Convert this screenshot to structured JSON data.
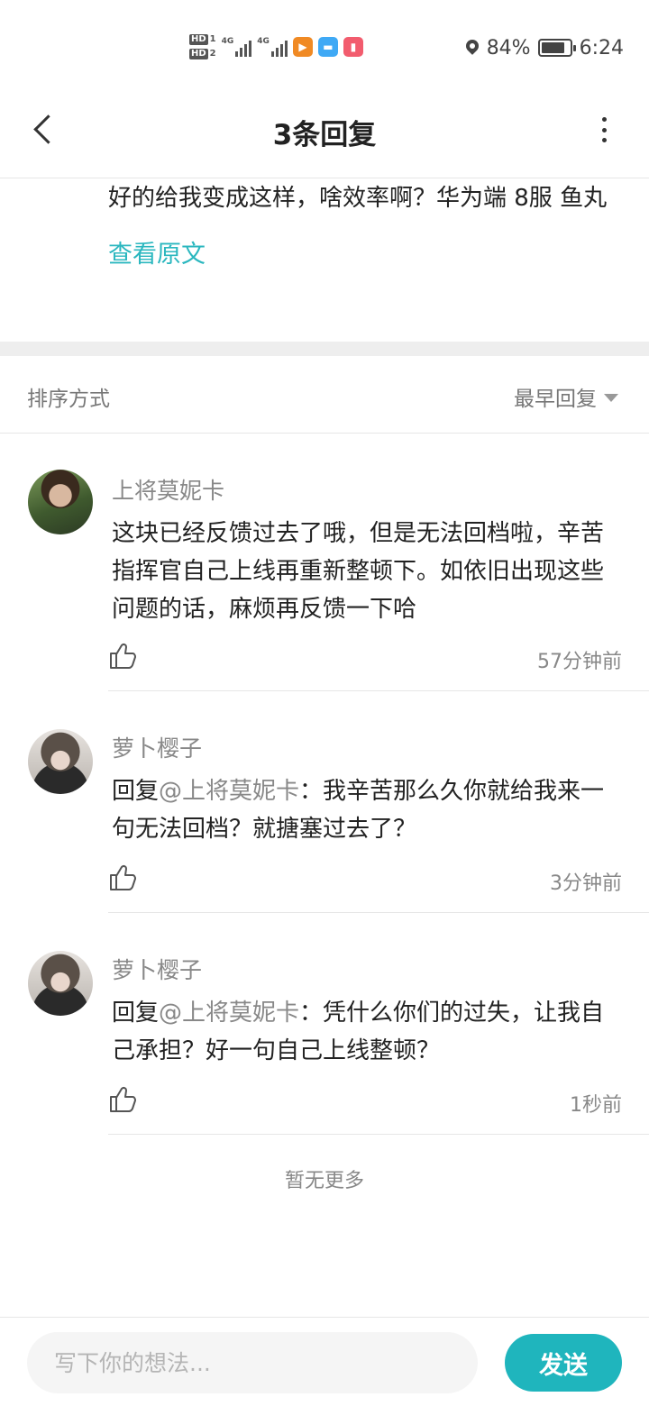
{
  "status_bar": {
    "hd1": "HD",
    "hd1_num": "1",
    "hd2": "HD",
    "hd2_num": "2",
    "net1": "4G",
    "net2": "4G",
    "battery": "84%",
    "time": "6:24",
    "battery_level": 0.84
  },
  "header": {
    "title": "3条回复"
  },
  "original": {
    "text": "好的给我变成这样，啥效率啊？华为端 8服 鱼丸",
    "view_link": "查看原文"
  },
  "sort": {
    "label": "排序方式",
    "value": "最早回复"
  },
  "comments": [
    {
      "name": "上将莫妮卡",
      "prefix": "",
      "mention": "",
      "body": "这块已经反馈过去了哦，但是无法回档啦，辛苦指挥官自己上线再重新整顿下。如依旧出现这些问题的话，麻烦再反馈一下哈",
      "time": "57分钟前"
    },
    {
      "name": "萝卜樱子",
      "prefix": "回复",
      "mention": "@上将莫妮卡",
      "body": "：我辛苦那么久你就给我来一句无法回档？就搪塞过去了？",
      "time": "3分钟前"
    },
    {
      "name": "萝卜樱子",
      "prefix": "回复",
      "mention": "@上将莫妮卡",
      "body": "：凭什么你们的过失，让我自己承担？好一句自己上线整顿？",
      "time": "1秒前"
    }
  ],
  "footer_text": "暂无更多",
  "input": {
    "placeholder": "写下你的想法..."
  },
  "send_label": "发送",
  "colors": {
    "accent": "#1fb5bd",
    "link": "#2bb7bf"
  }
}
